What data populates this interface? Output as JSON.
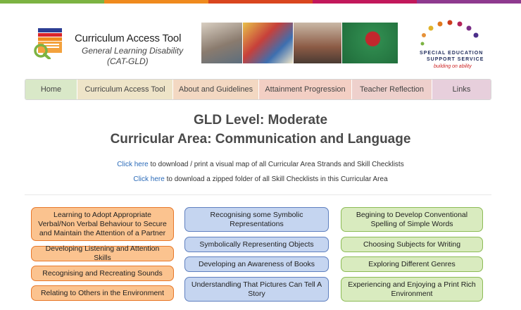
{
  "header": {
    "logo_title": "Curriculum Access Tool",
    "logo_subtitle": "General Learning Disability",
    "logo_subtitle2": "(CAT-GLD)",
    "sess_line1": "SPECIAL EDUCATION",
    "sess_line2": "SUPPORT SERVICE",
    "sess_tagline": "building on ability"
  },
  "nav": {
    "items": [
      "Home",
      "Curriculum Access Tool",
      "About and Guidelines",
      "Attainment Progression",
      "Teacher Reflection",
      "Links"
    ]
  },
  "main": {
    "level_heading": "GLD Level: Moderate",
    "area_heading": "Curricular Area: Communication and Language",
    "download1_link": "Click here",
    "download1_text": " to download / print a visual map of all Curricular Area Strands and Skill Checklists",
    "download2_link": "Click here",
    "download2_text": " to download a zipped folder of all Skill Checklists in this Curricular Area"
  },
  "strands": {
    "col1": [
      "Learning to Adopt Appropriate Verbal/Non Verbal Behaviour to Secure and Maintain the Attention of a Partner",
      "Developing Listening and Attention Skills",
      "Recognising and Recreating Sounds",
      "Relating to Others in the Environment"
    ],
    "col2": [
      "Recognising some Symbolic Representations",
      "Symbolically Representing Objects",
      "Developing an Awareness of Books",
      "Understandling That Pictures Can Tell A Story"
    ],
    "col3": [
      "Begining to Develop Conventional Spelling of Simple Words",
      "Choosing Subjects for Writing",
      "Exploring Different Genres",
      "Experiencing and Enjoying a Print Rich Environment"
    ]
  },
  "colors": {
    "strip": [
      "#6aa84f",
      "#e69138",
      "#cc4125",
      "#a64d79",
      "#674ea7"
    ],
    "nav": [
      "#d9e8c8",
      "#eee4c8",
      "#f3d8c2",
      "#f3cfc4",
      "#eed0cc",
      "#e7cfdc"
    ]
  }
}
